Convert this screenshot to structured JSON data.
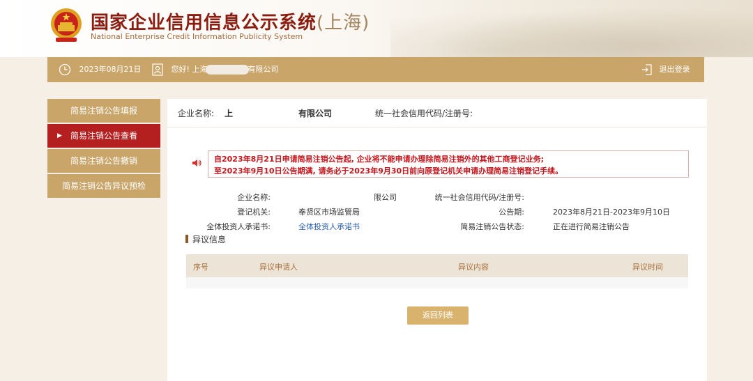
{
  "header": {
    "title_main": "国家企业信用信息公示系统",
    "title_region": "(上海)",
    "subtitle": "National Enterprise Credit Information Publicity System"
  },
  "topbar": {
    "date": "2023年08月21日",
    "greeting_prefix": "您好! 上海",
    "greeting_suffix": "有限公司",
    "logout": "退出登录"
  },
  "sidebar": {
    "items": [
      {
        "label": "简易注销公告填报",
        "active": false
      },
      {
        "label": "简易注销公告查看",
        "active": true
      },
      {
        "label": "简易注销公告撤销",
        "active": false
      },
      {
        "label": "简易注销公告异议预检",
        "active": false
      }
    ]
  },
  "infobar": {
    "name_label": "企业名称:",
    "name_prefix": "上",
    "name_suffix": "有限公司",
    "code_label": "统一社会信用代码/注册号:"
  },
  "notice": {
    "line1": "自2023年8月21日申请简易注销公告起, 企业将不能申请办理除简易注销外的其他工商登记业务;",
    "line2": "至2023年9月10日公告期满, 请务必于2023年9月30日前向原登记机关申请办理简易注销登记手续。"
  },
  "details": {
    "name_label": "企业名称:",
    "name_value": "限公司",
    "code_label": "统一社会信用代码/注册号:",
    "authority_label": "登记机关:",
    "authority_value": "奉贤区市场监管局",
    "period_label": "公告期:",
    "period_value": "2023年8月21日-2023年9月10日",
    "commitment_label": "全体投资人承诺书:",
    "commitment_link": "全体投资人承诺书",
    "status_label": "简易注销公告状态:",
    "status_value": "正在进行简易注销公告"
  },
  "objection": {
    "section_title": "异议信息",
    "columns": [
      "序号",
      "异议申请人",
      "异议内容",
      "异议时间"
    ]
  },
  "back_button": "返回列表",
  "colors": {
    "gold": "#c9a56a",
    "active_red": "#b41f1f",
    "notice_red": "#c4161c",
    "title_red": "#8a1c10"
  }
}
